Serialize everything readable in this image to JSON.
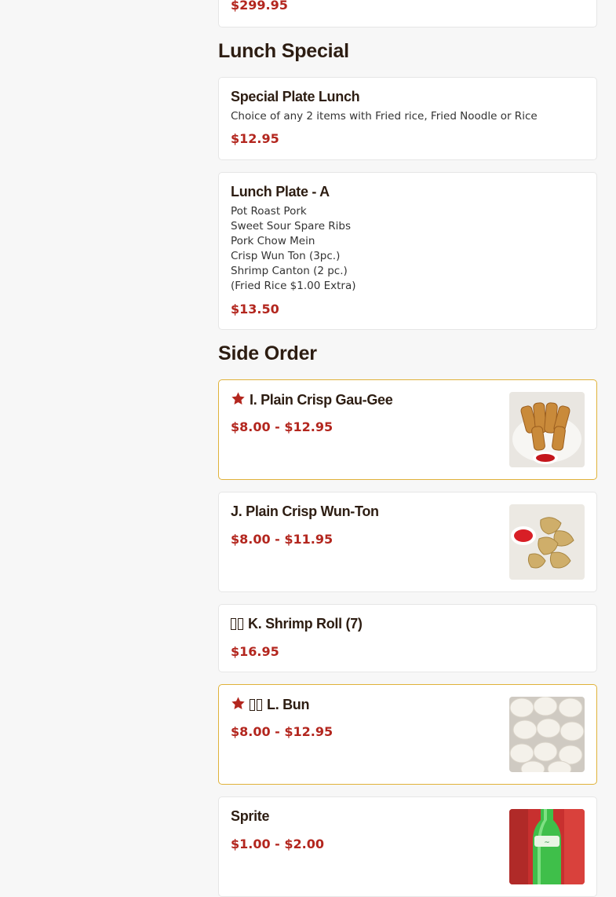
{
  "colors": {
    "accent": "#b3261e",
    "featured_border": "#e0b23a",
    "heading": "#2d1d12"
  },
  "top_partial": {
    "price": "$299.95"
  },
  "sections": [
    {
      "title": "Lunch Special",
      "items": [
        {
          "name": "Special Plate Lunch",
          "description": "Choice of any 2 items with Fried rice, Fried Noodle or Rice",
          "price": "$12.95"
        },
        {
          "name": "Lunch Plate - A",
          "description": "Pot Roast Pork\nSweet Sour Spare Ribs\nPork Chow Mein\nCrisp Wun Ton (3pc.)\nShrimp Canton (2 pc.)\n(Fried Rice $1.00 Extra)",
          "price": "$13.50"
        }
      ]
    },
    {
      "title": "Side Order",
      "items": [
        {
          "name": "I. Plain Crisp Gau-Gee",
          "price": "$8.00 - $12.95",
          "featured": true,
          "icon": "star-icon",
          "image": "gau-gee-photo"
        },
        {
          "name": "J. Plain Crisp Wun-Ton",
          "price": "$8.00 - $11.95",
          "image": "wun-ton-photo"
        },
        {
          "name": "K. Shrimp Roll (7)",
          "price": "$16.95",
          "icon": "missing-glyph-icon"
        },
        {
          "name": "L. Bun",
          "price": "$8.00 - $12.95",
          "featured": true,
          "icon": "star-icon",
          "image": "bun-photo"
        },
        {
          "name": "Sprite",
          "price": "$1.00 - $2.00",
          "image": "sprite-bottle-photo"
        }
      ]
    }
  ]
}
